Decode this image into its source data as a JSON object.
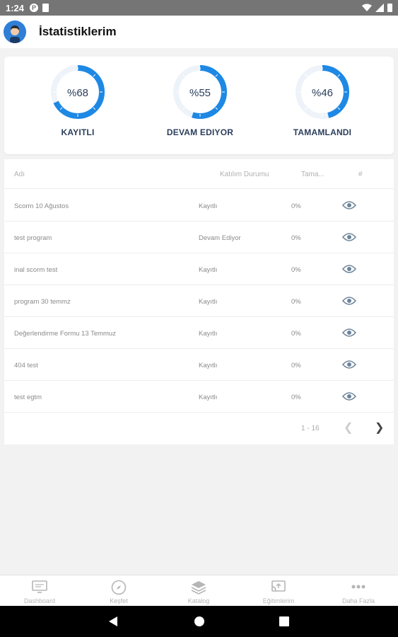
{
  "status_bar": {
    "time": "1:24"
  },
  "header": {
    "title": "İstatistiklerim"
  },
  "stats": [
    {
      "label": "KAYITLI",
      "percent_text": "%68",
      "value": 68
    },
    {
      "label": "DEVAM EDIYOR",
      "percent_text": "%55",
      "value": 55
    },
    {
      "label": "TAMAMLANDI",
      "percent_text": "%46",
      "value": 46
    }
  ],
  "colors": {
    "accent": "#1e88e5",
    "text_dark": "#2b3e5c"
  },
  "table": {
    "headers": {
      "name": "Adı",
      "status": "Katılım Durumu",
      "completion": "Tama...",
      "action": "#"
    },
    "rows": [
      {
        "name": "Scorm 10 Ağustos",
        "status": "Kayıtlı",
        "completion": "0%"
      },
      {
        "name": "test program",
        "status": "Devam Ediyor",
        "completion": "0%"
      },
      {
        "name": "inal scorm test",
        "status": "Kayıtlı",
        "completion": "0%"
      },
      {
        "name": "program 30 temmz",
        "status": "Kayıtlı",
        "completion": "0%"
      },
      {
        "name": "Değerlendirme Formu 13 Temmuz",
        "status": "Kayıtlı",
        "completion": "0%"
      },
      {
        "name": "404 test",
        "status": "Kayıtlı",
        "completion": "0%"
      },
      {
        "name": "test egtm",
        "status": "Kayıtlı",
        "completion": "0%"
      }
    ],
    "pagination": {
      "range": "1 - 16"
    }
  },
  "bottom_nav": [
    {
      "label": "Dashboard",
      "icon": "dashboard-icon"
    },
    {
      "label": "Keşfet",
      "icon": "compass-icon"
    },
    {
      "label": "Katalog",
      "icon": "layers-icon"
    },
    {
      "label": "Eğitimlerim",
      "icon": "cast-icon"
    },
    {
      "label": "Daha Fazla",
      "icon": "more-icon"
    }
  ]
}
